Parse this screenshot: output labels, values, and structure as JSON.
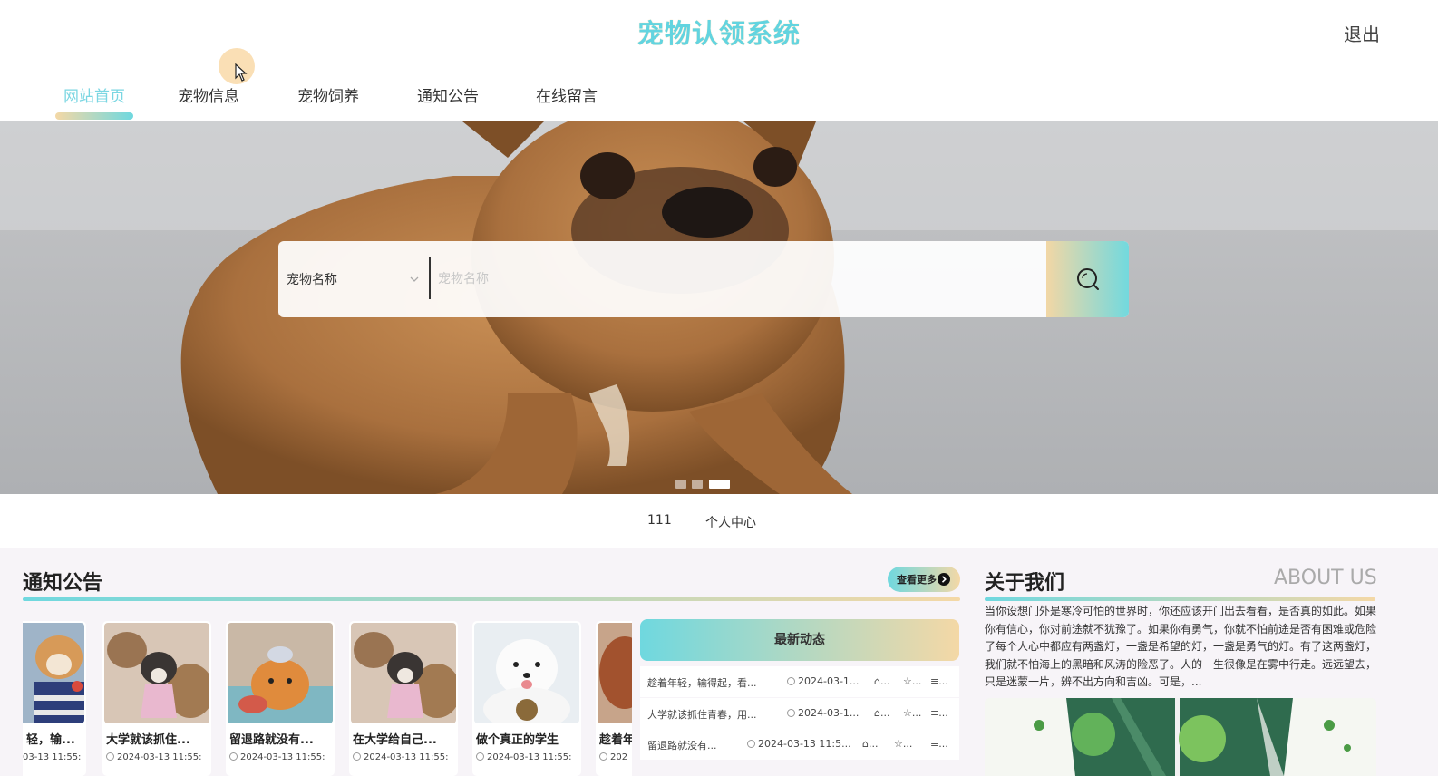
{
  "header": {
    "site_title": "宠物认领系统",
    "logout_label": "退出",
    "nav": [
      {
        "label": "网站首页",
        "active": true
      },
      {
        "label": "宠物信息",
        "active": false
      },
      {
        "label": "宠物饲养",
        "active": false
      },
      {
        "label": "通知公告",
        "active": false
      },
      {
        "label": "在线留言",
        "active": false
      }
    ]
  },
  "search": {
    "select_value": "宠物名称",
    "placeholder": "宠物名称",
    "button_icon": "search-icon"
  },
  "carousel": {
    "slides": 3,
    "active_index": 2
  },
  "user_bar": {
    "username": "111",
    "center_label": "个人中心"
  },
  "notices": {
    "title": "通知公告",
    "more_label": "查看更多",
    "cards": [
      {
        "title": "轻，输...",
        "time": "03-13 11:55:"
      },
      {
        "title": "大学就该抓住...",
        "time": "2024-03-13 11:55:"
      },
      {
        "title": "留退路就没有...",
        "time": "2024-03-13 11:55:"
      },
      {
        "title": "在大学给自己...",
        "time": "2024-03-13 11:55:"
      },
      {
        "title": "做个真正的学生",
        "time": "2024-03-13 11:55:"
      },
      {
        "title": "趁着年",
        "time": "202"
      }
    ]
  },
  "news": {
    "title": "最新动态",
    "rows": [
      {
        "title": "趁着年轻，输得起，看...",
        "time": "2024-03-1...",
        "like": "...",
        "collect": "...",
        "comment": "..."
      },
      {
        "title": "大学就该抓住青春，用...",
        "time": "2024-03-1...",
        "like": "...",
        "collect": "...",
        "comment": "..."
      },
      {
        "title": "留退路就没有...",
        "time": "2024-03-13 11:5...",
        "like": "...",
        "collect": "...",
        "comment": "..."
      }
    ]
  },
  "about": {
    "title": "关于我们",
    "title_en": "ABOUT US",
    "text": "当你设想门外是寒冷可怕的世界时，你还应该开门出去看看，是否真的如此。如果你有信心，你对前途就不犹豫了。如果你有勇气，你就不怕前途是否有困难或危险了每个人心中都应有两盏灯，一盏是希望的灯，一盏是勇气的灯。有了这两盏灯，我们就不怕海上的黑暗和风涛的险恶了。人的一生很像是在雾中行走。远远望去，只是迷蒙一片，辨不出方向和吉凶。可是，..."
  },
  "colors": {
    "accent_teal": "#6fd8df",
    "accent_sand": "#f4d8a6",
    "title": "#62d4e0"
  }
}
